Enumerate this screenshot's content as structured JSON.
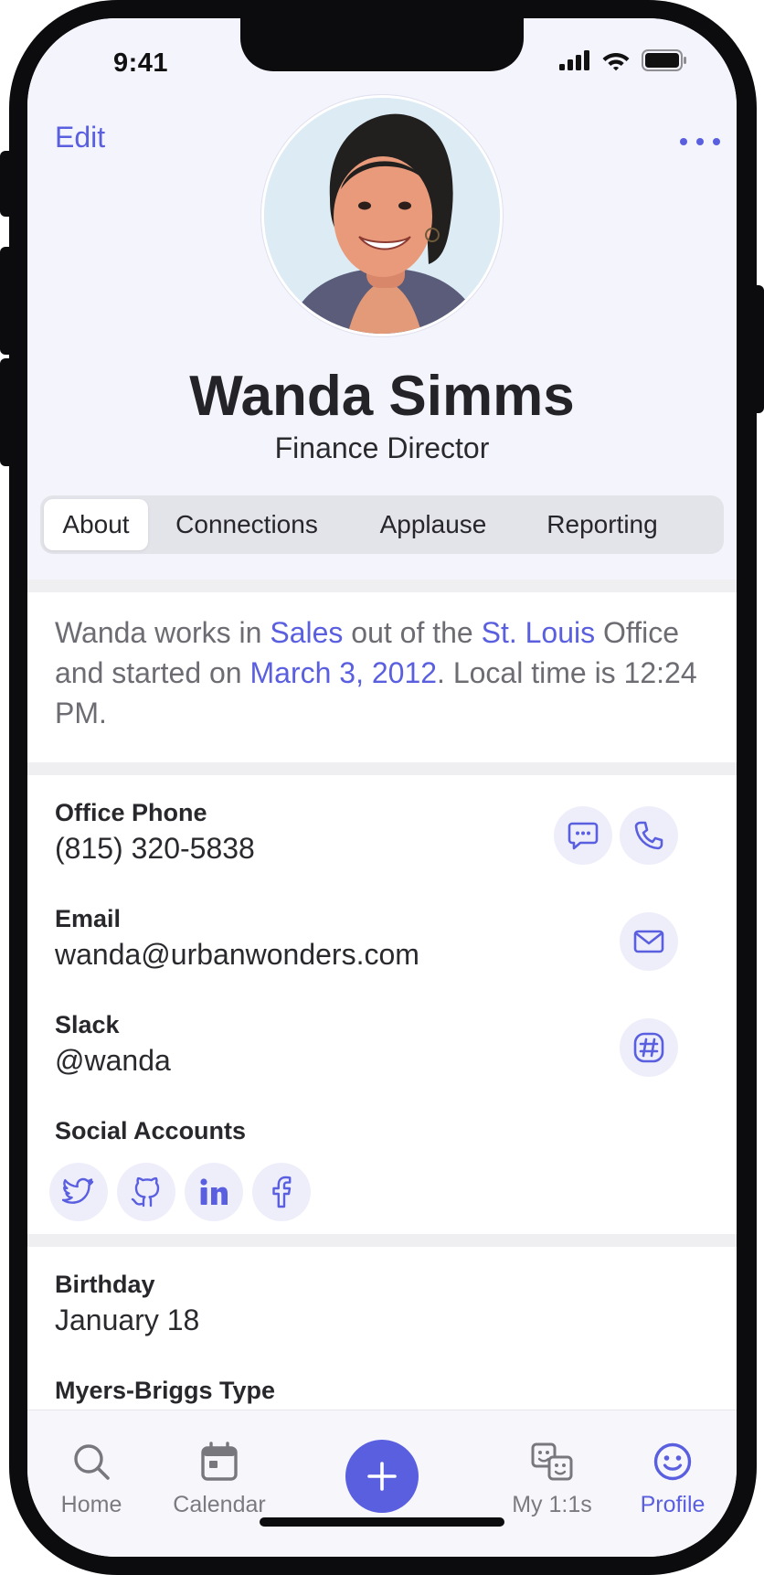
{
  "status_bar": {
    "time": "9:41"
  },
  "header": {
    "edit_label": "Edit",
    "name": "Wanda Simms",
    "job_title": "Finance Director"
  },
  "tabs": [
    {
      "label": "About",
      "active": true
    },
    {
      "label": "Connections",
      "active": false
    },
    {
      "label": "Applause",
      "active": false
    },
    {
      "label": "Reporting",
      "active": false
    }
  ],
  "about": {
    "t1": "Wanda works in ",
    "department": "Sales",
    "t2": " out of the ",
    "office": "St. Louis",
    "t3": " Office and started on ",
    "start_date": "March 3, 2012",
    "t4": ". Local time is 12:24 PM."
  },
  "contact": {
    "phone_label": "Office Phone",
    "phone_value": "(815) 320-5838",
    "email_label": "Email",
    "email_value": "wanda@urbanwonders.com",
    "slack_label": "Slack",
    "slack_value": "@wanda",
    "social_label": "Social Accounts"
  },
  "details": {
    "birthday_label": "Birthday",
    "birthday_value": "January 18",
    "mbti_label": "Myers-Briggs Type"
  },
  "bottom_nav": {
    "home": "Home",
    "calendar": "Calendar",
    "one_on_ones": "My 1:1s",
    "profile": "Profile"
  },
  "colors": {
    "accent": "#5a5fe0",
    "header_bg": "#f4f4fd",
    "icon_bg": "#eeeefb"
  }
}
